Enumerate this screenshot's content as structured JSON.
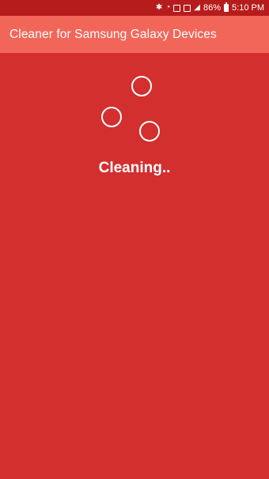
{
  "status_bar": {
    "battery": "86%",
    "time": "5:10 PM",
    "icons": [
      "bluetooth-icon",
      "wifi-icon",
      "nfc-icon",
      "vibrate-icon",
      "signal-icon",
      "battery-icon"
    ]
  },
  "app_bar": {
    "title": "Cleaner for Samsung Galaxy Devices"
  },
  "main": {
    "status_text": "Cleaning.."
  },
  "colors": {
    "background": "#d32f2f",
    "app_bar": "#f2665a",
    "status_bar": "#b71c1c",
    "foreground": "#ffffff"
  }
}
